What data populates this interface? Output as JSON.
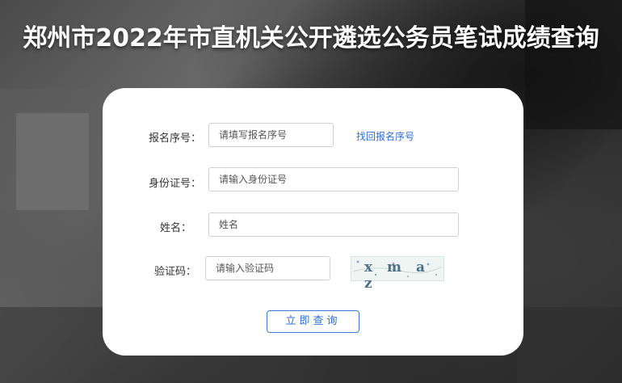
{
  "page": {
    "title": "郑州市2022年市直机关公开遴选公务员笔试成绩查询"
  },
  "form": {
    "reg_no_label": "报名序号：",
    "reg_no_placeholder": "请填写报名序号",
    "find_reg_no_link": "找回报名序号",
    "id_label": "身份证号：",
    "id_placeholder": "请输入身份证号",
    "name_label": "姓名：",
    "name_placeholder": "姓名",
    "captcha_label": "验证码：",
    "captcha_placeholder": "请输入验证码",
    "captcha_text": "x m a z",
    "submit_label": "立即查询"
  },
  "colors": {
    "link": "#2f6fd1",
    "button_border": "#3b78d8"
  }
}
